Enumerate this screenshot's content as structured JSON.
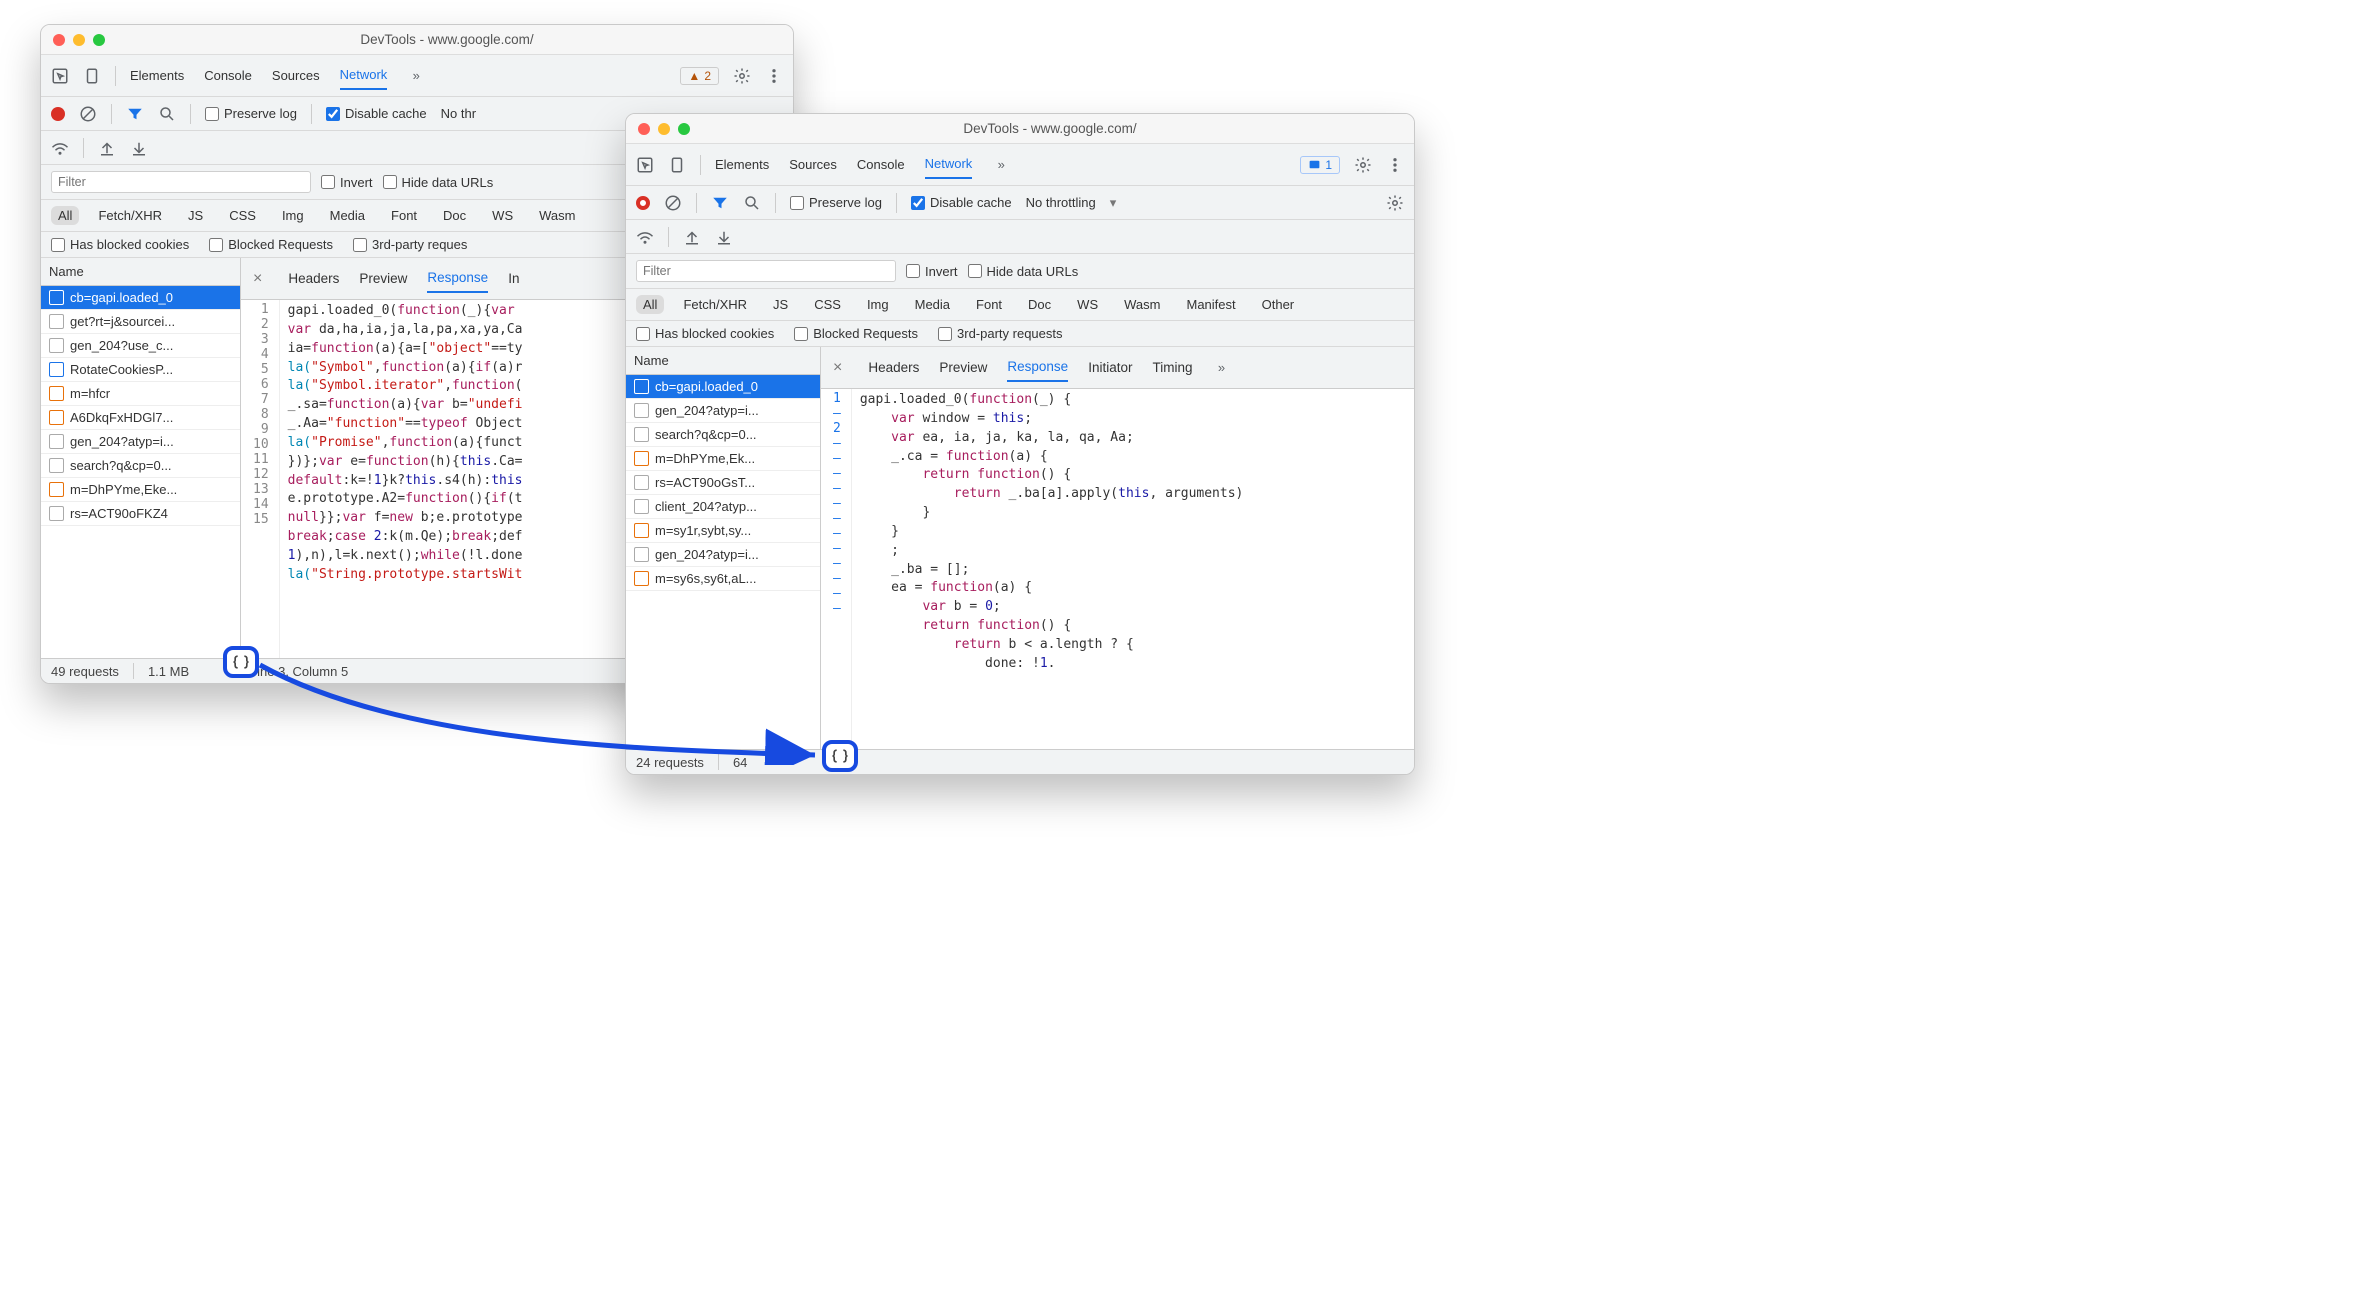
{
  "title": "DevTools - www.google.com/",
  "panels": [
    "Elements",
    "Console",
    "Sources",
    "Network"
  ],
  "panels_win2": [
    "Elements",
    "Sources",
    "Console",
    "Network"
  ],
  "warn_count": "2",
  "info_count": "1",
  "net_toolbar": {
    "preserve": "Preserve log",
    "disable_cache": "Disable cache",
    "throttling1": "No thr",
    "throttling2": "No throttling"
  },
  "filter": {
    "placeholder": "Filter",
    "invert": "Invert",
    "hide_data": "Hide data URLs",
    "blocked_cookies": "Has blocked cookies",
    "blocked_req": "Blocked Requests",
    "third_party": "3rd-party reques",
    "third_party2": "3rd-party requests"
  },
  "chips": [
    "All",
    "Fetch/XHR",
    "JS",
    "CSS",
    "Img",
    "Media",
    "Font",
    "Doc",
    "WS",
    "Wasm"
  ],
  "chips2_extra": [
    "Manifest",
    "Other"
  ],
  "list_hdr": "Name",
  "detail_tabs": [
    "Headers",
    "Preview",
    "Response",
    "In"
  ],
  "detail_tabs2": [
    "Headers",
    "Preview",
    "Response",
    "Initiator",
    "Timing"
  ],
  "win1_rows": [
    {
      "t": "cb=gapi.loaded_0",
      "sel": true,
      "ic": "doc"
    },
    {
      "t": "get?rt=j&sourcei...",
      "ic": "plain"
    },
    {
      "t": "gen_204?use_c...",
      "ic": "plain"
    },
    {
      "t": "RotateCookiesP...",
      "ic": "doc"
    },
    {
      "t": "m=hfcr",
      "ic": "orange"
    },
    {
      "t": "A6DkqFxHDGl7...",
      "ic": "orange"
    },
    {
      "t": "gen_204?atyp=i...",
      "ic": "plain"
    },
    {
      "t": "search?q&cp=0...",
      "ic": "plain"
    },
    {
      "t": "m=DhPYme,Eke...",
      "ic": "orange"
    },
    {
      "t": "rs=ACT90oFKZ4",
      "ic": "plain"
    }
  ],
  "win2_rows": [
    {
      "t": "cb=gapi.loaded_0",
      "sel": true,
      "ic": "doc"
    },
    {
      "t": "gen_204?atyp=i...",
      "ic": "plain"
    },
    {
      "t": "search?q&cp=0...",
      "ic": "plain"
    },
    {
      "t": "m=DhPYme,Ek...",
      "ic": "orange"
    },
    {
      "t": "rs=ACT90oGsT...",
      "ic": "plain"
    },
    {
      "t": "client_204?atyp...",
      "ic": "plain"
    },
    {
      "t": "m=sy1r,sybt,sy...",
      "ic": "orange"
    },
    {
      "t": "gen_204?atyp=i...",
      "ic": "plain"
    },
    {
      "t": "m=sy6s,sy6t,aL...",
      "ic": "orange"
    }
  ],
  "status1": {
    "req": "49 requests",
    "size": "1.1 MB",
    "cursor": "ine 3, Column 5"
  },
  "status2": {
    "req": "24 requests",
    "size": "64"
  },
  "code1": {
    "gutter": [
      "1",
      "2",
      "3",
      "4",
      "5",
      "6",
      "7",
      "8",
      "9",
      "10",
      "11",
      "12",
      "13",
      "14",
      "15"
    ],
    "lines": [
      [
        {
          "c": "gapi.loaded_0(",
          "t": ""
        },
        {
          "c": "function",
          "t": "kw"
        },
        {
          "c": "(_){",
          "t": ""
        },
        {
          "c": "var",
          "t": "kw"
        }
      ],
      [
        {
          "c": "var",
          "t": "kw"
        },
        {
          "c": " da,ha,ia,ja,la,pa,xa,ya,Ca",
          "t": ""
        }
      ],
      [
        {
          "c": "ia=",
          "t": ""
        },
        {
          "c": "function",
          "t": "kw"
        },
        {
          "c": "(a){a=[",
          "t": ""
        },
        {
          "c": "\"object\"",
          "t": "str"
        },
        {
          "c": "==ty",
          "t": ""
        }
      ],
      [
        {
          "c": "la(",
          "t": "fn"
        },
        {
          "c": "\"Symbol\"",
          "t": "str"
        },
        {
          "c": ",",
          "t": ""
        },
        {
          "c": "function",
          "t": "kw"
        },
        {
          "c": "(a){",
          "t": ""
        },
        {
          "c": "if",
          "t": "kw"
        },
        {
          "c": "(a)r",
          "t": ""
        }
      ],
      [
        {
          "c": "la(",
          "t": "fn"
        },
        {
          "c": "\"Symbol.iterator\"",
          "t": "str"
        },
        {
          "c": ",",
          "t": ""
        },
        {
          "c": "function",
          "t": "kw"
        },
        {
          "c": "(",
          "t": ""
        }
      ],
      [
        {
          "c": "_.sa=",
          "t": ""
        },
        {
          "c": "function",
          "t": "kw"
        },
        {
          "c": "(a){",
          "t": ""
        },
        {
          "c": "var",
          "t": "kw"
        },
        {
          "c": " b=",
          "t": ""
        },
        {
          "c": "\"undefi",
          "t": "str"
        }
      ],
      [
        {
          "c": "_.Aa=",
          "t": ""
        },
        {
          "c": "\"function\"",
          "t": "str"
        },
        {
          "c": "==",
          "t": ""
        },
        {
          "c": "typeof",
          "t": "kw"
        },
        {
          "c": " Object",
          "t": ""
        }
      ],
      [
        {
          "c": "la(",
          "t": "fn"
        },
        {
          "c": "\"Promise\"",
          "t": "str"
        },
        {
          "c": ",",
          "t": ""
        },
        {
          "c": "function",
          "t": "kw"
        },
        {
          "c": "(a){funct",
          "t": ""
        }
      ],
      [
        {
          "c": "})};",
          "t": ""
        },
        {
          "c": "var",
          "t": "kw"
        },
        {
          "c": " e=",
          "t": ""
        },
        {
          "c": "function",
          "t": "kw"
        },
        {
          "c": "(h){",
          "t": ""
        },
        {
          "c": "this",
          "t": "this"
        },
        {
          "c": ".Ca=",
          "t": ""
        }
      ],
      [
        {
          "c": "default",
          "t": "kw"
        },
        {
          "c": ":k=!",
          "t": ""
        },
        {
          "c": "1",
          "t": "num"
        },
        {
          "c": "}k?",
          "t": ""
        },
        {
          "c": "this",
          "t": "this"
        },
        {
          "c": ".s4(h):",
          "t": ""
        },
        {
          "c": "this",
          "t": "this"
        }
      ],
      [
        {
          "c": "e.prototype.A2=",
          "t": ""
        },
        {
          "c": "function",
          "t": "kw"
        },
        {
          "c": "(){",
          "t": ""
        },
        {
          "c": "if",
          "t": "kw"
        },
        {
          "c": "(t",
          "t": ""
        }
      ],
      [
        {
          "c": "null",
          "t": "kw"
        },
        {
          "c": "}};",
          "t": ""
        },
        {
          "c": "var",
          "t": "kw"
        },
        {
          "c": " f=",
          "t": ""
        },
        {
          "c": "new",
          "t": "kw"
        },
        {
          "c": " b;e.prototype",
          "t": ""
        }
      ],
      [
        {
          "c": "break",
          "t": "kw"
        },
        {
          "c": ";",
          "t": ""
        },
        {
          "c": "case",
          "t": "kw"
        },
        {
          "c": " ",
          "t": ""
        },
        {
          "c": "2",
          "t": "num"
        },
        {
          "c": ":k(m.Qe);",
          "t": ""
        },
        {
          "c": "break",
          "t": "kw"
        },
        {
          "c": ";def",
          "t": ""
        }
      ],
      [
        {
          "c": "1",
          "t": "num"
        },
        {
          "c": "),n),l=k.next();",
          "t": ""
        },
        {
          "c": "while",
          "t": "kw"
        },
        {
          "c": "(!l.done",
          "t": ""
        }
      ],
      [
        {
          "c": "la(",
          "t": "fn"
        },
        {
          "c": "\"String.prototype.startsWit",
          "t": "str"
        }
      ]
    ]
  },
  "code2": {
    "gutter": [
      "1",
      "–",
      "2",
      "–",
      "–",
      "–",
      "–",
      "–",
      "–",
      "–",
      "–",
      "–",
      "–",
      "–",
      "–"
    ],
    "lines": [
      [
        {
          "c": "gapi.loaded_0(",
          "t": ""
        },
        {
          "c": "function",
          "t": "kw"
        },
        {
          "c": "(_) {",
          "t": ""
        }
      ],
      [
        {
          "c": "    var",
          "t": "kw"
        },
        {
          "c": " window = ",
          "t": ""
        },
        {
          "c": "this",
          "t": "this"
        },
        {
          "c": ";",
          "t": ""
        }
      ],
      [
        {
          "c": "    var",
          "t": "kw"
        },
        {
          "c": " ea, ia, ja, ka, la, qa, Aa;",
          "t": ""
        }
      ],
      [
        {
          "c": "    _.ca = ",
          "t": ""
        },
        {
          "c": "function",
          "t": "kw"
        },
        {
          "c": "(a) {",
          "t": ""
        }
      ],
      [
        {
          "c": "        return",
          "t": "kw"
        },
        {
          "c": " ",
          "t": ""
        },
        {
          "c": "function",
          "t": "kw"
        },
        {
          "c": "() {",
          "t": ""
        }
      ],
      [
        {
          "c": "            return",
          "t": "kw"
        },
        {
          "c": " _.ba[a].apply(",
          "t": ""
        },
        {
          "c": "this",
          "t": "this"
        },
        {
          "c": ", arguments)",
          "t": ""
        }
      ],
      [
        {
          "c": "        }",
          "t": ""
        }
      ],
      [
        {
          "c": "    }",
          "t": ""
        }
      ],
      [
        {
          "c": "    ;",
          "t": ""
        }
      ],
      [
        {
          "c": "    _.ba = [];",
          "t": ""
        }
      ],
      [
        {
          "c": "    ea = ",
          "t": ""
        },
        {
          "c": "function",
          "t": "kw"
        },
        {
          "c": "(a) {",
          "t": ""
        }
      ],
      [
        {
          "c": "        var",
          "t": "kw"
        },
        {
          "c": " b = ",
          "t": ""
        },
        {
          "c": "0",
          "t": "num"
        },
        {
          "c": ";",
          "t": ""
        }
      ],
      [
        {
          "c": "        return",
          "t": "kw"
        },
        {
          "c": " ",
          "t": ""
        },
        {
          "c": "function",
          "t": "kw"
        },
        {
          "c": "() {",
          "t": ""
        }
      ],
      [
        {
          "c": "            return",
          "t": "kw"
        },
        {
          "c": " b < a.length ? {",
          "t": ""
        }
      ],
      [
        {
          "c": "                done: !",
          "t": ""
        },
        {
          "c": "1",
          "t": "num"
        },
        {
          "c": ".",
          "t": ""
        }
      ]
    ]
  }
}
